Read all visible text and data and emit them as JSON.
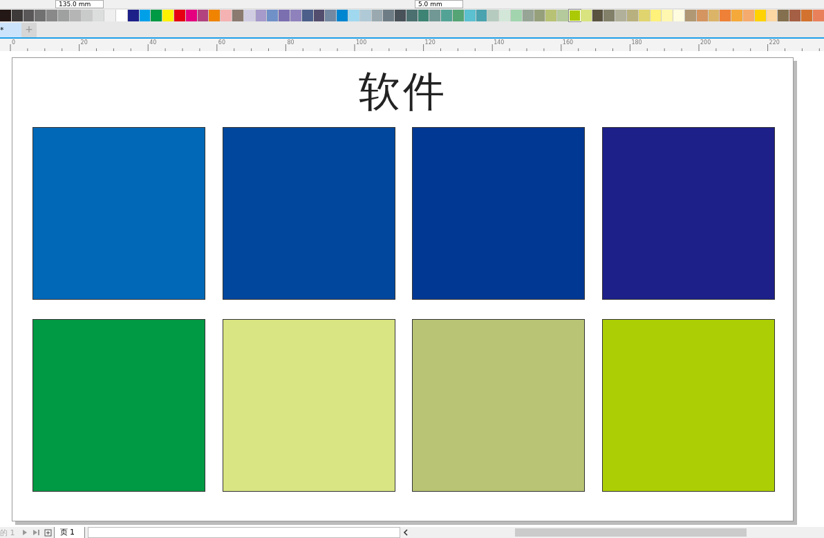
{
  "toolbar": {
    "fields": [
      {
        "value": "135.0 mm"
      },
      {
        "value": "5.0 mm"
      }
    ]
  },
  "palette": [
    {
      "color": "#231815",
      "selected": false
    },
    {
      "color": "#3e3a39",
      "selected": false
    },
    {
      "color": "#595757",
      "selected": false
    },
    {
      "color": "#727171",
      "selected": false
    },
    {
      "color": "#898989",
      "selected": false
    },
    {
      "color": "#9fa0a0",
      "selected": false
    },
    {
      "color": "#b5b5b6",
      "selected": false
    },
    {
      "color": "#c9caca",
      "selected": false
    },
    {
      "color": "#dcdddd",
      "selected": false
    },
    {
      "color": "#efefef",
      "selected": false
    },
    {
      "color": "#ffffff",
      "selected": false
    },
    {
      "color": "#1d2088",
      "selected": false
    },
    {
      "color": "#00a0e9",
      "selected": false
    },
    {
      "color": "#009944",
      "selected": false
    },
    {
      "color": "#fff100",
      "selected": false
    },
    {
      "color": "#e60012",
      "selected": false
    },
    {
      "color": "#e4007f",
      "selected": false
    },
    {
      "color": "#b2437f",
      "selected": false
    },
    {
      "color": "#f08300",
      "selected": false
    },
    {
      "color": "#f5b2b2",
      "selected": false
    },
    {
      "color": "#8a7a70",
      "selected": false
    },
    {
      "color": "#d0cde3",
      "selected": false
    },
    {
      "color": "#a59aca",
      "selected": false
    },
    {
      "color": "#7090c8",
      "selected": false
    },
    {
      "color": "#7c6fb0",
      "selected": false
    },
    {
      "color": "#8f82bc",
      "selected": false
    },
    {
      "color": "#4c5f8a",
      "selected": false
    },
    {
      "color": "#534e6e",
      "selected": false
    },
    {
      "color": "#7388a1",
      "selected": false
    },
    {
      "color": "#0086d1",
      "selected": false
    },
    {
      "color": "#a0d8ef",
      "selected": false
    },
    {
      "color": "#b0c9d6",
      "selected": false
    },
    {
      "color": "#9aa9b0",
      "selected": false
    },
    {
      "color": "#6e7c85",
      "selected": false
    },
    {
      "color": "#4a5259",
      "selected": false
    },
    {
      "color": "#4c7070",
      "selected": false
    },
    {
      "color": "#3e8475",
      "selected": false
    },
    {
      "color": "#729895",
      "selected": false
    },
    {
      "color": "#52a396",
      "selected": false
    },
    {
      "color": "#55a475",
      "selected": false
    },
    {
      "color": "#5bc0cf",
      "selected": false
    },
    {
      "color": "#4aa3ae",
      "selected": false
    },
    {
      "color": "#b6cbbf",
      "selected": false
    },
    {
      "color": "#d3e7d8",
      "selected": false
    },
    {
      "color": "#a2d4ad",
      "selected": false
    },
    {
      "color": "#97a596",
      "selected": false
    },
    {
      "color": "#96a07b",
      "selected": false
    },
    {
      "color": "#b8c274",
      "selected": false
    },
    {
      "color": "#b4c99c",
      "selected": false
    },
    {
      "color": "#acc906",
      "selected": true
    },
    {
      "color": "#d9e37f",
      "selected": false
    },
    {
      "color": "#595340",
      "selected": false
    },
    {
      "color": "#828069",
      "selected": false
    },
    {
      "color": "#b1b09a",
      "selected": false
    },
    {
      "color": "#b8b07e",
      "selected": false
    },
    {
      "color": "#e0d46e",
      "selected": false
    },
    {
      "color": "#fff17a",
      "selected": false
    },
    {
      "color": "#fff7b0",
      "selected": false
    },
    {
      "color": "#fffcdf",
      "selected": false
    },
    {
      "color": "#b09874",
      "selected": false
    },
    {
      "color": "#d49560",
      "selected": false
    },
    {
      "color": "#dbb468",
      "selected": false
    },
    {
      "color": "#ee8137",
      "selected": false
    },
    {
      "color": "#f5a93a",
      "selected": false
    },
    {
      "color": "#f5ab6e",
      "selected": false
    },
    {
      "color": "#ffd200",
      "selected": false
    },
    {
      "color": "#fcd6a3",
      "selected": false
    },
    {
      "color": "#84704f",
      "selected": false
    },
    {
      "color": "#a55f44",
      "selected": false
    },
    {
      "color": "#d3722e",
      "selected": false
    },
    {
      "color": "#e9805c",
      "selected": false
    }
  ],
  "document_tabs": [
    {
      "label": "*",
      "selected": true
    }
  ],
  "new_tab": {
    "label": "+"
  },
  "ruler": {
    "labels": [
      "0",
      "20",
      "40",
      "60",
      "80",
      "100",
      "120",
      "140",
      "160",
      "180",
      "200",
      "220"
    ]
  },
  "page": {
    "title": "软件",
    "swatches": [
      {
        "color": "#0068b7"
      },
      {
        "color": "#00479d"
      },
      {
        "color": "#003894"
      },
      {
        "color": "#1d2088"
      },
      {
        "color": "#009944"
      },
      {
        "color": "#d9e483"
      },
      {
        "color": "#b9c474"
      },
      {
        "color": "#acce04"
      }
    ]
  },
  "status": {
    "page_counter": "的 1",
    "page_tabs": [
      {
        "label": "页 1",
        "selected": true
      }
    ]
  }
}
